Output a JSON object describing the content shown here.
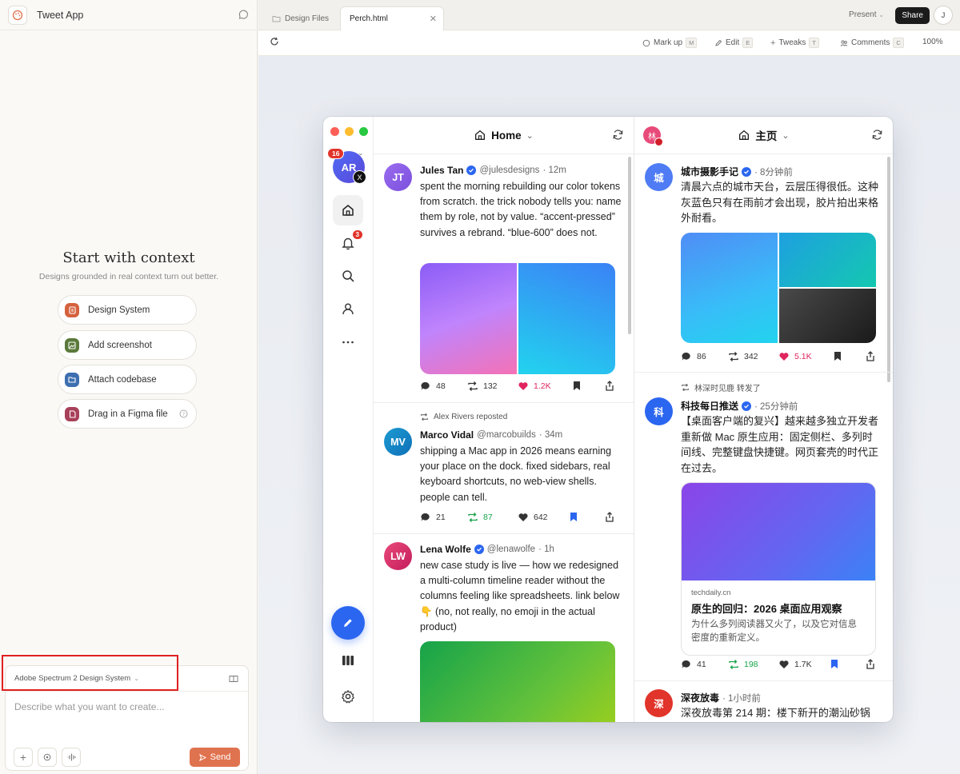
{
  "left_panel": {
    "app_title": "Tweet App",
    "context": {
      "title": "Start with context",
      "subtitle": "Designs grounded in real context turn out better.",
      "buttons": [
        {
          "label": "Design System",
          "icon": "design-system-icon",
          "color": "#d4623d"
        },
        {
          "label": "Add screenshot",
          "icon": "image-icon",
          "color": "#5a7a3a"
        },
        {
          "label": "Attach codebase",
          "icon": "code-folder-icon",
          "color": "#3d6fb0"
        },
        {
          "label": "Drag in a Figma file",
          "icon": "figma-file-icon",
          "color": "#a8405a"
        }
      ]
    },
    "prompt": {
      "design_system": "Adobe Spectrum 2 Design System",
      "placeholder": "Describe what you want to create...",
      "send_label": "Send"
    }
  },
  "tabs": {
    "items": [
      {
        "label": "Design Files"
      },
      {
        "label": "Perch.html"
      }
    ],
    "present_label": "Present",
    "share_label": "Share",
    "user_initial": "J"
  },
  "toolbar": {
    "markup": {
      "label": "Mark up",
      "key": "M"
    },
    "edit": {
      "label": "Edit",
      "key": "E"
    },
    "tweaks": {
      "label": "Tweaks",
      "key": "T"
    },
    "comments": {
      "label": "Comments",
      "key": "C"
    },
    "zoom": "100%"
  },
  "app": {
    "account": {
      "initials": "AR",
      "badge": "16",
      "network": "X"
    },
    "notifications_badge": "3",
    "colors": {
      "accent": "#2b66f0",
      "like": "#e0245e",
      "repost": "#17a34a",
      "badge": "#e1342a"
    },
    "col1": {
      "title": "Home",
      "posts": [
        {
          "initials": "JT",
          "name": "Jules Tan",
          "handle": "@julesdesigns",
          "time": "· 12m",
          "text": "spent the morning rebuilding our color tokens from scratch. the trick nobody tells you: name them by role, not by value. “accent-pressed” survives a rebrand. “blue-600” does not.",
          "replies": "48",
          "reposts": "132",
          "likes": "1.2K"
        },
        {
          "repost_by": "Alex Rivers reposted",
          "initials": "MV",
          "name": "Marco Vidal",
          "handle": "@marcobuilds",
          "time": "· 34m",
          "text": "shipping a Mac app in 2026 means earning your place on the dock. fixed sidebars, real keyboard shortcuts, no web-view shells. people can tell.",
          "replies": "21",
          "reposts": "87",
          "likes": "642"
        },
        {
          "initials": "LW",
          "name": "Lena Wolfe",
          "handle": "@lenawolfe",
          "time": "· 1h",
          "text": "new case study is live — how we redesigned a multi-column timeline reader without the columns feeling like spreadsheets. link below 👇 (no, not really, no emoji in the actual product)"
        }
      ]
    },
    "col2": {
      "title": "主页",
      "account_initial": "林",
      "posts": [
        {
          "initials": "城",
          "name": "城市摄影手记",
          "time": "· 8分钟前",
          "text": "清晨六点的城市天台，云层压得很低。这种灰蓝色只有在雨前才会出现，胶片拍出来格外耐看。",
          "replies": "86",
          "reposts": "342",
          "likes": "5.1K"
        },
        {
          "repost_by": "林深时见鹿 转发了",
          "initials": "科",
          "name": "科技每日推送",
          "time": "· 25分钟前",
          "text": "【桌面客户端的复兴】越来越多独立开发者重新做 Mac 原生应用：固定侧栏、多列时间线、完整键盘快捷键。网页套壳的时代正在过去。",
          "link": {
            "domain": "techdaily.cn",
            "title": "原生的回归：2026 桌面应用观察",
            "desc": "为什么多列阅读器又火了，以及它对信息密度的重新定义。"
          },
          "replies": "41",
          "reposts": "198",
          "likes": "1.7K"
        },
        {
          "initials": "深",
          "name": "深夜放毒",
          "time": "· 1小时前",
          "text": "深夜放毒第 214 期：楼下新开的潮汕砂锅"
        }
      ]
    }
  }
}
